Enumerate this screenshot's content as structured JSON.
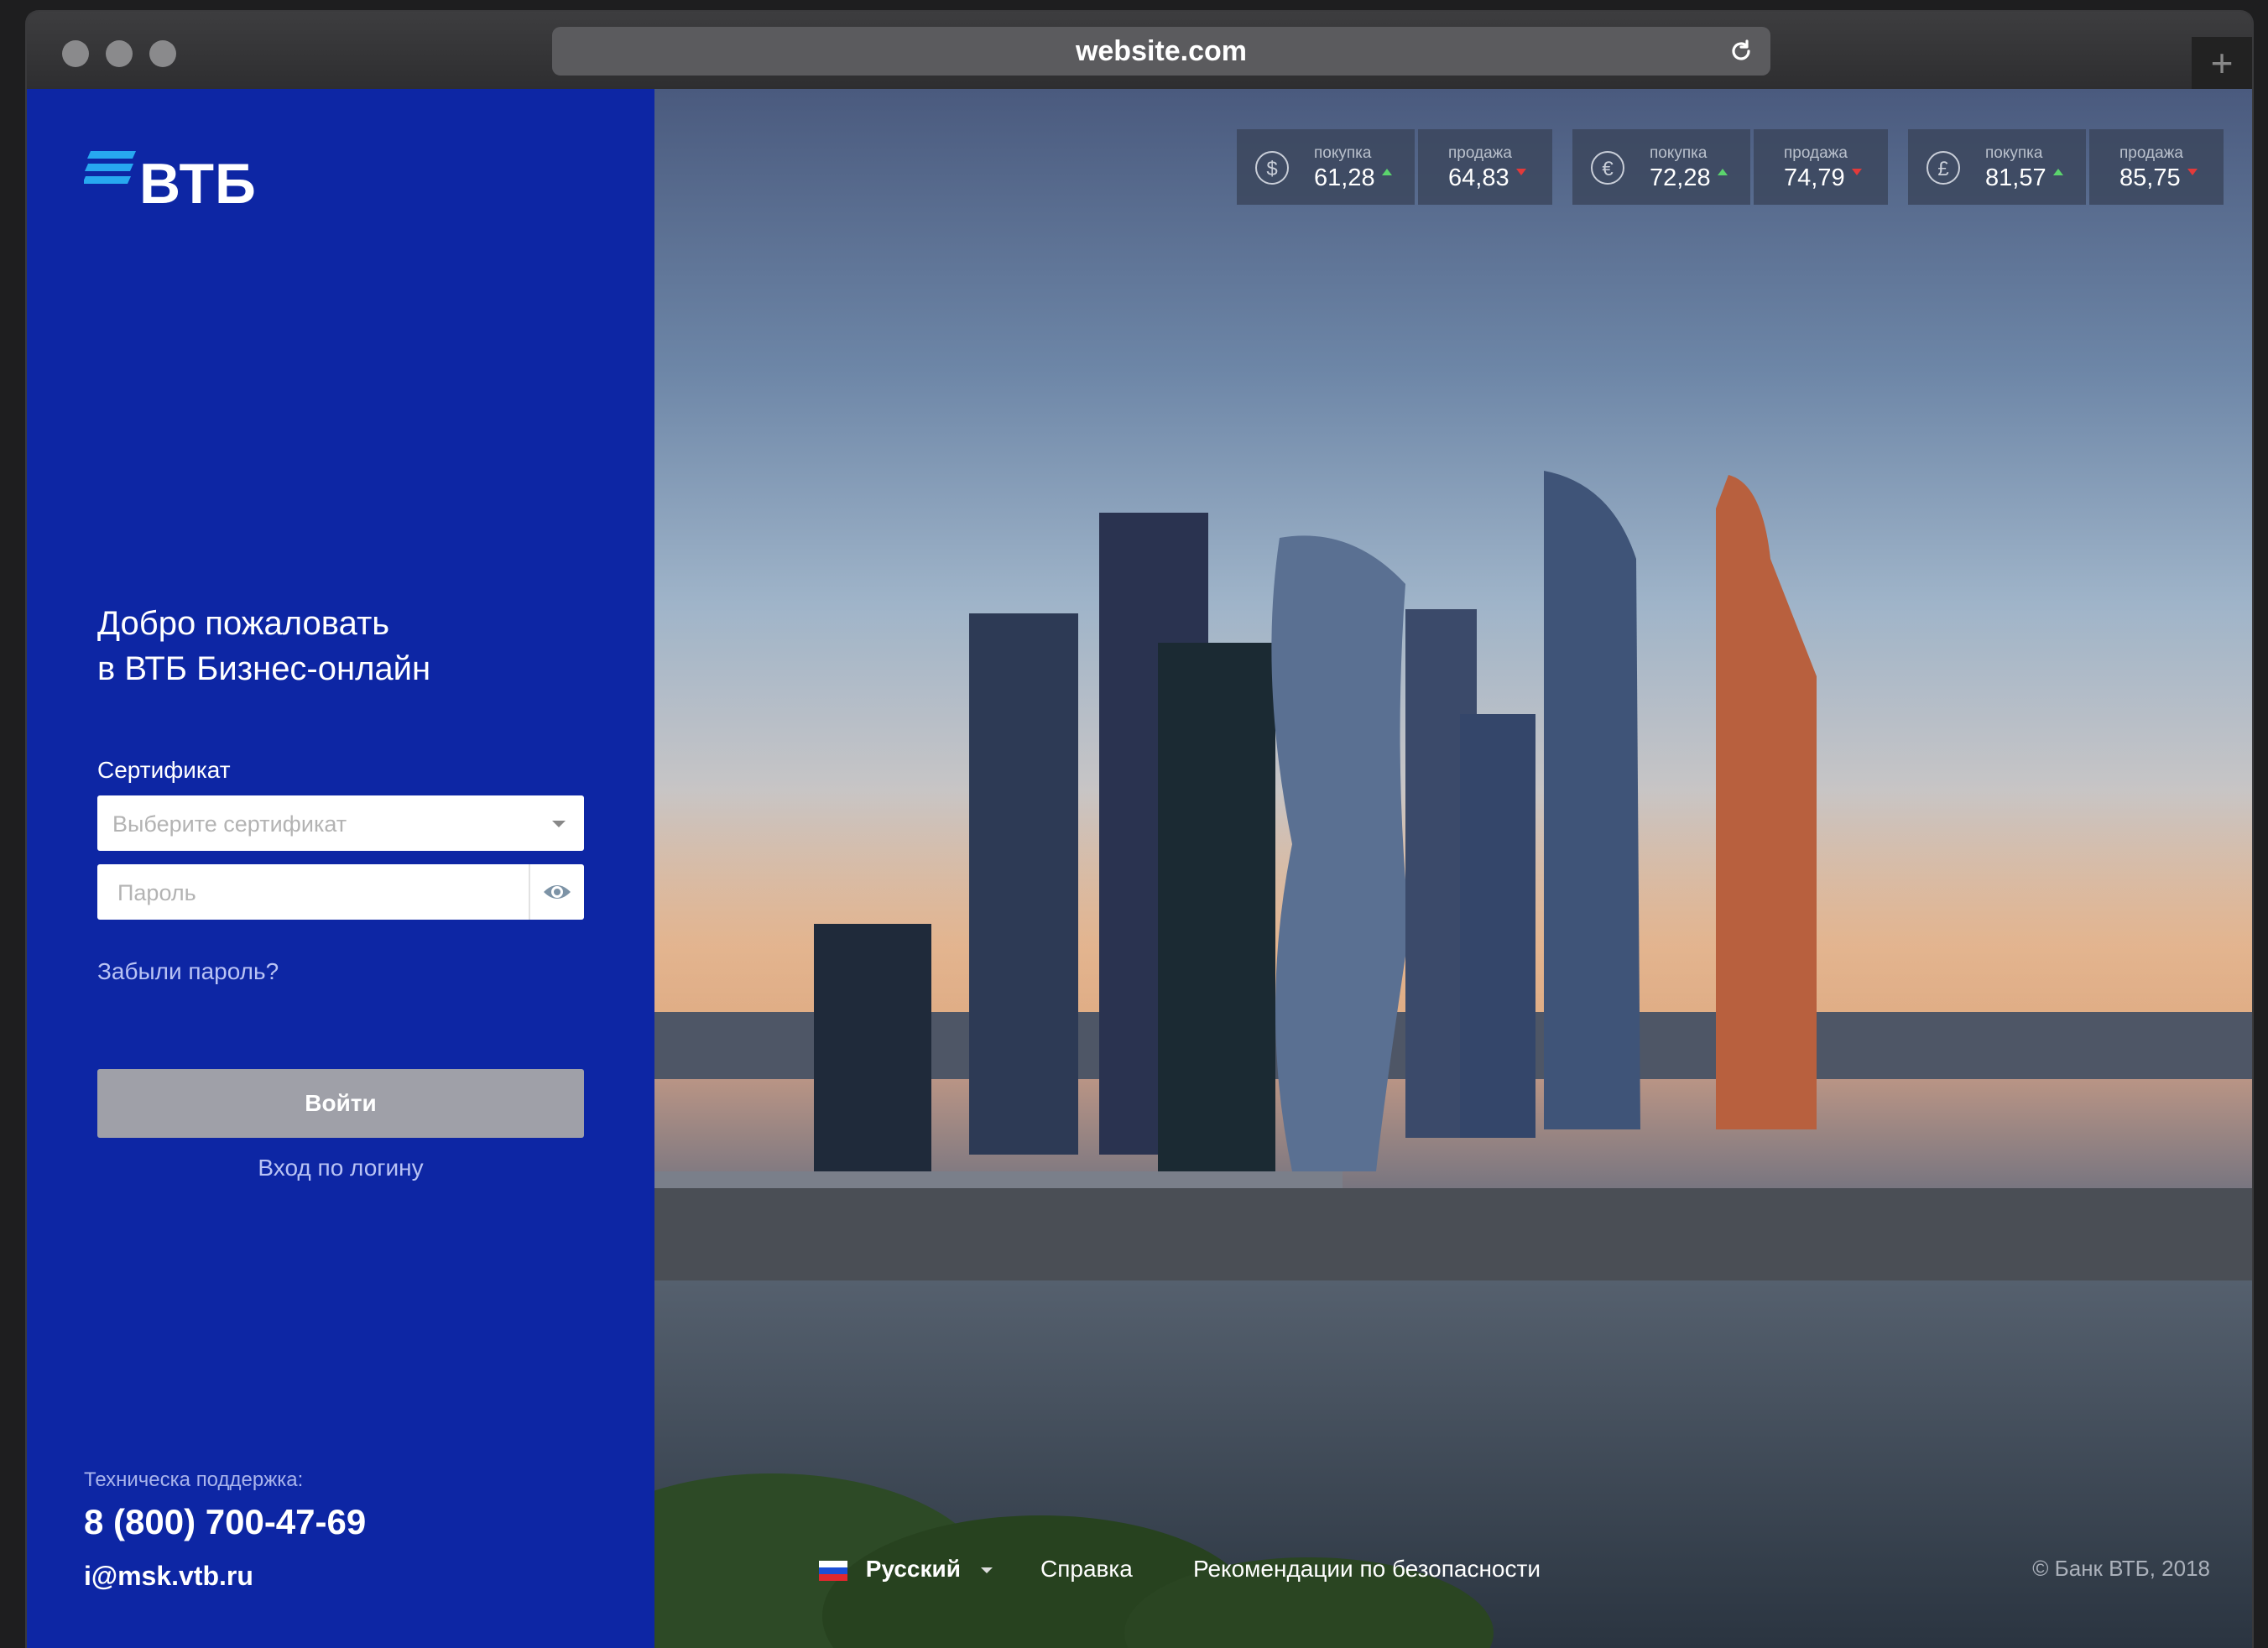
{
  "browser": {
    "url": "website.com"
  },
  "brand": {
    "logo_text": "ВТБ",
    "color": "#0d26a4"
  },
  "login": {
    "welcome_line1": "Добро пожаловать",
    "welcome_line2": "в ВТБ Бизнес-онлайн",
    "certificate_label": "Сертификат",
    "certificate_placeholder": "Выберите сертификат",
    "password_placeholder": "Пароль",
    "forgot_password": "Забыли пароль?",
    "login_button": "Войти",
    "login_by_username": "Вход по логину"
  },
  "support": {
    "label": "Техническа поддержка:",
    "phone": "8 (800) 700-47-69",
    "email": "i@msk.vtb.ru"
  },
  "rates": [
    {
      "currency_symbol": "$",
      "buy_label": "покупка",
      "buy": "61,28",
      "buy_trend": "up",
      "sell_label": "продажа",
      "sell": "64,83",
      "sell_trend": "down"
    },
    {
      "currency_symbol": "€",
      "buy_label": "покупка",
      "buy": "72,28",
      "buy_trend": "up",
      "sell_label": "продажа",
      "sell": "74,79",
      "sell_trend": "down"
    },
    {
      "currency_symbol": "£",
      "buy_label": "покупка",
      "buy": "81,57",
      "buy_trend": "up",
      "sell_label": "продажа",
      "sell": "85,75",
      "sell_trend": "down"
    }
  ],
  "footer": {
    "language": "Русский",
    "help": "Справка",
    "security": "Рекомендации по безопасности",
    "copyright": "© Банк ВТБ, 2018"
  }
}
